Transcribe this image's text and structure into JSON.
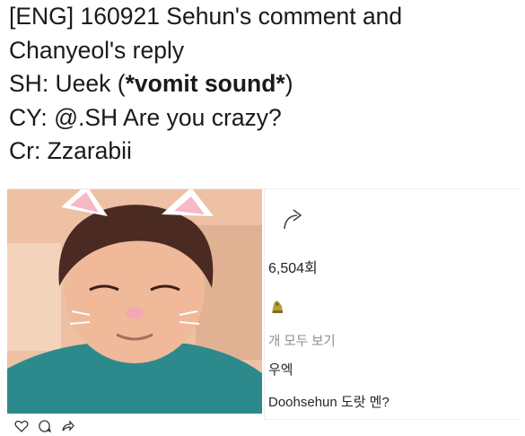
{
  "caption": {
    "line1": "[ENG] 160921 Sehun's comment and",
    "line2": "Chanyeol's reply",
    "line3_prefix": "SH: Ueek (",
    "line3_bold": "*vomit sound*",
    "line3_suffix": ")",
    "line4": "CY: @.SH Are you crazy?",
    "line5": "Cr: Zzarabii"
  },
  "post": {
    "views": "6,504회",
    "view_all_comments": "개 모두 보기",
    "comments": [
      {
        "text": "우엑"
      },
      {
        "text": "Doohsehun 도랏 멘?"
      }
    ]
  },
  "icons": {
    "share": "share-arrow-icon",
    "heart": "heart-icon",
    "comment": "comment-icon",
    "repost": "share-icon",
    "sticker": "sticker-icon"
  },
  "colors": {
    "text": "#1a1a1a",
    "muted": "#8e8e8e",
    "photo_bg": "#e7b394",
    "shirt": "#2d8a8c"
  }
}
